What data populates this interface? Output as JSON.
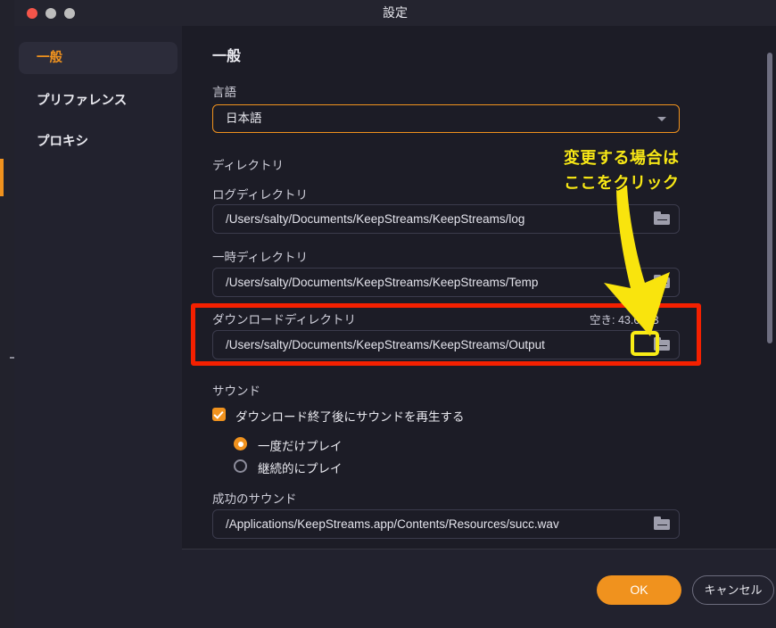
{
  "window": {
    "title": "設定",
    "traffic_lights": [
      "close-button",
      "minimize-button",
      "maximize-button"
    ]
  },
  "sidebar": {
    "items": [
      {
        "label": "一般",
        "active": true
      },
      {
        "label": "プリファレンス",
        "active": false
      },
      {
        "label": "プロキシ",
        "active": false
      }
    ]
  },
  "main": {
    "pane_title": "一般",
    "language": {
      "label": "言語",
      "value": "日本語",
      "caret_icon": "chevron-down-icon"
    },
    "directory": {
      "section_label": "ディレクトリ",
      "log": {
        "label": "ログディレクトリ",
        "value": "/Users/salty/Documents/KeepStreams/KeepStreams/log",
        "browse_icon": "folder-icon"
      },
      "temp": {
        "label": "一時ディレクトリ",
        "value": "/Users/salty/Documents/KeepStreams/KeepStreams/Temp",
        "browse_icon": "folder-icon"
      },
      "download": {
        "label": "ダウンロードディレクトリ",
        "free_space": "空き: 43.6 GB",
        "value": "/Users/salty/Documents/KeepStreams/KeepStreams/Output",
        "browse_icon": "folder-icon"
      }
    },
    "sound": {
      "section_label": "サウンド",
      "play_after_download": {
        "label": "ダウンロード終了後にサウンドを再生する",
        "checked": true
      },
      "options": [
        {
          "label": "一度だけプレイ",
          "selected": true
        },
        {
          "label": "継続的にプレイ",
          "selected": false
        }
      ],
      "success_sound": {
        "label": "成功のサウンド",
        "value": "/Applications/KeepStreams.app/Contents/Resources/succ.wav",
        "browse_icon": "folder-icon"
      }
    }
  },
  "footer": {
    "ok_label": "OK",
    "cancel_label": "キャンセル"
  },
  "annotation": {
    "line1": "変更する場合は",
    "line2": "ここをクリック",
    "arrow_icon": "down-arrow-annotation",
    "highlight_color": "#f42000",
    "target_highlight_color": "#f9ec16",
    "text_color": "#f7e716"
  },
  "colors": {
    "accent": "#f0921e",
    "window_bg": "#22222e",
    "content_bg": "#1c1c26"
  }
}
